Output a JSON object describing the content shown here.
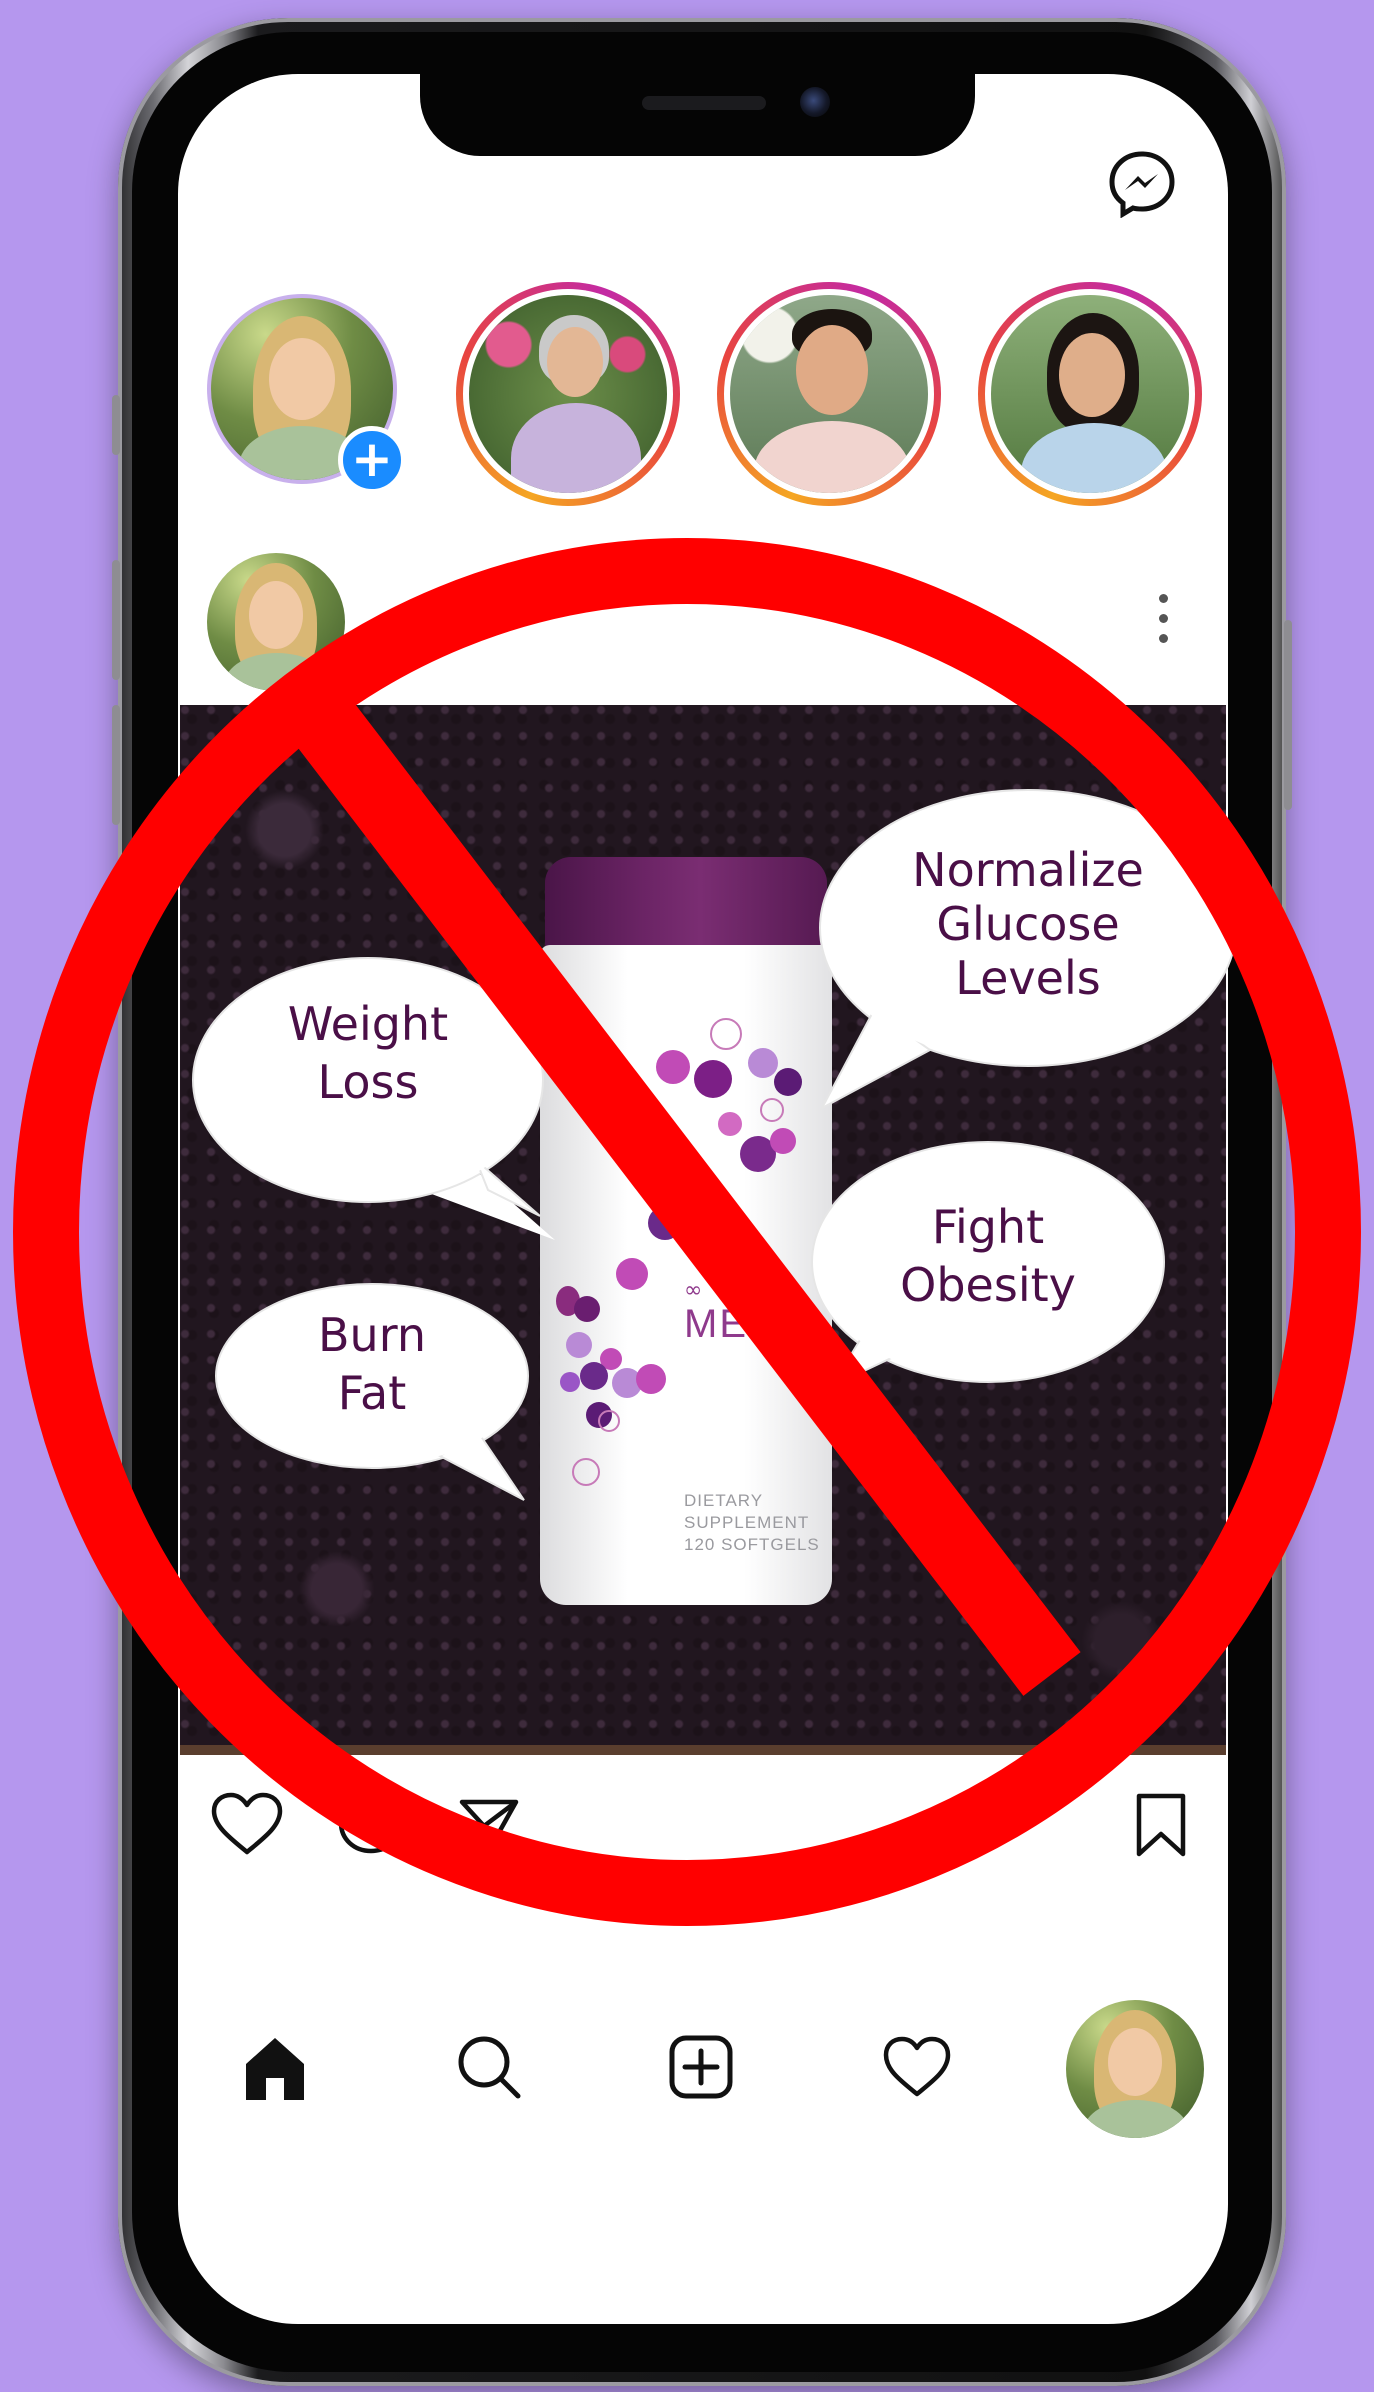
{
  "icons": {
    "messenger": "messenger-icon",
    "add_story": "plus-icon",
    "more": "more-vertical-icon",
    "like": "heart-outline-icon",
    "comment": "comment-icon",
    "share": "send-icon",
    "save": "bookmark-icon",
    "home": "home-icon",
    "search": "search-icon",
    "create": "add-post-icon",
    "activity": "heart-outline-icon",
    "profile": "avatar"
  },
  "add_story_glyph": "+",
  "bottle": {
    "brand": "ME",
    "label_lines": [
      "DIETARY",
      "SUPPLEMENT",
      "120 SOFTGELS"
    ]
  },
  "bubbles": {
    "weight_loss": [
      "Weight",
      "Loss"
    ],
    "burn_fat": [
      "Burn",
      "Fat"
    ],
    "glucose": [
      "Normalize",
      "Glucose",
      "Levels"
    ],
    "obesity": [
      "Fight",
      "Obesity"
    ]
  },
  "colors": {
    "background": "#b597ee",
    "prohibition_red": "#ff0000",
    "bubble_text": "#4a0f47",
    "badge_blue": "#1a8cff",
    "bottle_cap": "#6b2465"
  }
}
